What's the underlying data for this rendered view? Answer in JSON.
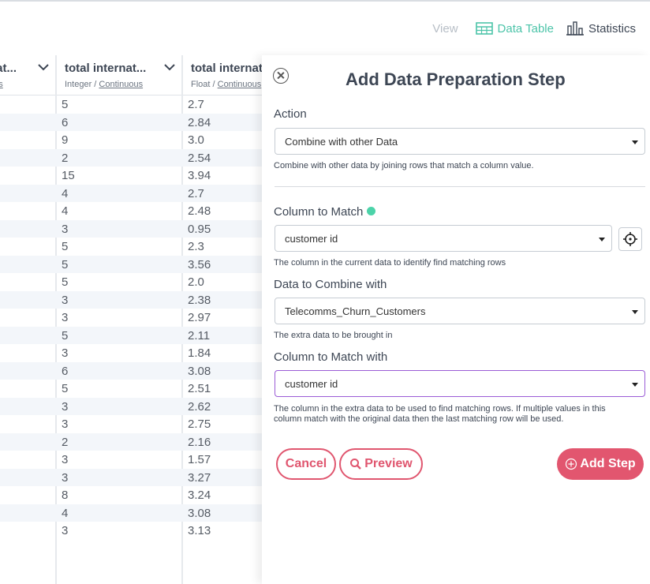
{
  "view": {
    "label": "View",
    "options": [
      {
        "label": "Data Table",
        "icon": "table-icon",
        "active": true
      },
      {
        "label": "Statistics",
        "icon": "bar-chart-icon",
        "active": false
      }
    ]
  },
  "table": {
    "columns": [
      {
        "name": "nat...",
        "type_prefix": "",
        "type_suffix": "ous"
      },
      {
        "name": "total internat...",
        "type_prefix": "Integer / ",
        "type_suffix": "Continuous"
      },
      {
        "name": "total internat",
        "type_prefix": "Float / ",
        "type_suffix": "Continuous"
      }
    ],
    "rows": [
      [
        "5",
        "2.7"
      ],
      [
        "6",
        "2.84"
      ],
      [
        "9",
        "3.0"
      ],
      [
        "2",
        "2.54"
      ],
      [
        "15",
        "3.94"
      ],
      [
        "4",
        "2.7"
      ],
      [
        "4",
        "2.48"
      ],
      [
        "3",
        "0.95"
      ],
      [
        "5",
        "2.3"
      ],
      [
        "5",
        "3.56"
      ],
      [
        "5",
        "2.0"
      ],
      [
        "3",
        "2.38"
      ],
      [
        "3",
        "2.97"
      ],
      [
        "5",
        "2.11"
      ],
      [
        "3",
        "1.84"
      ],
      [
        "6",
        "3.08"
      ],
      [
        "5",
        "2.51"
      ],
      [
        "3",
        "2.62"
      ],
      [
        "3",
        "2.75"
      ],
      [
        "2",
        "2.16"
      ],
      [
        "3",
        "1.57"
      ],
      [
        "3",
        "3.27"
      ],
      [
        "8",
        "3.24"
      ],
      [
        "4",
        "3.08"
      ],
      [
        "3",
        "3.13"
      ]
    ]
  },
  "panel": {
    "title": "Add Data Preparation Step",
    "action": {
      "label": "Action",
      "value": "Combine with other Data",
      "help": "Combine with other data by joining rows that match a column value."
    },
    "column_to_match": {
      "label": "Column to Match",
      "value": "customer id",
      "help": "The column in the current data to identify find matching rows"
    },
    "data_to_combine": {
      "label": "Data to Combine with",
      "value": "Telecomms_Churn_Customers",
      "help": "The extra data to be brought in"
    },
    "column_to_match_with": {
      "label": "Column to Match with",
      "value": "customer id",
      "help": "The column in the extra data to be used to find matching rows. If multiple values in this column match with the original data then the last matching row will be used."
    },
    "buttons": {
      "cancel": "Cancel",
      "preview": "Preview",
      "add_step": "Add Step"
    },
    "colors": {
      "accent": "#e2566f",
      "teal": "#4cc4a9",
      "focus": "#9b5cd6"
    }
  }
}
